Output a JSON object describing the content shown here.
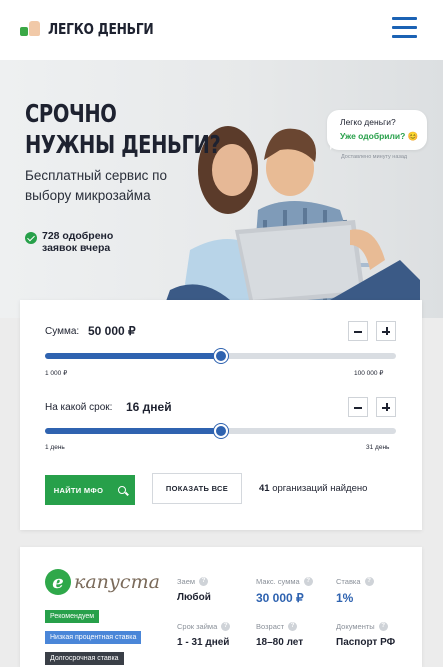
{
  "header": {
    "logo_text": "ЛЕГКО ДЕНЬГИ"
  },
  "hero": {
    "title_line1": "СРОЧНО",
    "title_line2": "НУЖНЫ ДЕНЬГИ?",
    "subtitle": "Бесплатный сервис по выбору микрозайма",
    "stat_line1": "728 одобрено",
    "stat_line2": "заявок вчера",
    "bubble_question": "Легко деньги?",
    "bubble_answer": "Уже одобрили?",
    "bubble_emoji": "😊",
    "bubble_meta": "Доставлено минуту назад"
  },
  "calculator": {
    "amount_label": "Сумма:",
    "amount_value": "50 000 ₽",
    "amount_min": "1 000 ₽",
    "amount_max": "100 000 ₽",
    "amount_fraction": 0.5,
    "term_label": "На какой срок:",
    "term_value": "16 дней",
    "term_min": "1 день",
    "term_max": "31 день",
    "term_fraction": 0.5,
    "find_button": "НАЙТИ МФО",
    "show_all_button": "ПОКАЗАТЬ ВСЕ",
    "found_count": "41",
    "found_text": "организаций найдено"
  },
  "offer": {
    "brand_letter": "e",
    "brand_name": "капуста",
    "tags": [
      "Рекомендуем",
      "Низкая процентная ставка",
      "Долгосрочная ставка"
    ],
    "loan_label": "Заем",
    "loan_value": "Любой",
    "max_sum_label": "Макс. сумма",
    "max_sum_value": "30 000 ₽",
    "rate_label": "Ставка",
    "rate_value": "1%",
    "term_label": "Срок займа",
    "term_value": "1 - 31 дней",
    "age_label": "Возраст",
    "age_value": "18–80 лет",
    "docs_label": "Документы",
    "docs_value": "Паспорт РФ"
  },
  "colors": {
    "brand_green": "#27a04a",
    "brand_blue": "#2f63b0"
  }
}
